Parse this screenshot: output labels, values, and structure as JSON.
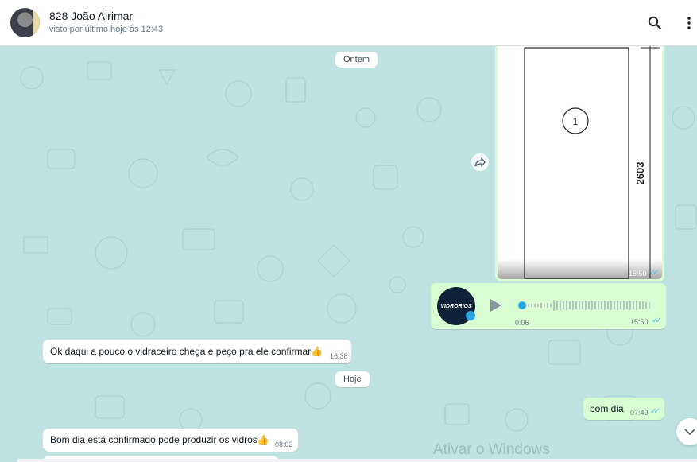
{
  "header": {
    "contact_name": "828 João Alrimar",
    "last_seen": "visto por último hoje às 12:43",
    "search_icon": "search-icon",
    "menu_icon": "more-vertical-icon"
  },
  "image_message": {
    "dimension_label": "2603",
    "circle_label": "1",
    "time": "15:50",
    "status": "read"
  },
  "date_separators": [
    "Ontem",
    "Hoje"
  ],
  "voice_message": {
    "logo_text": "VIDRORIOS",
    "duration": "0:06",
    "time": "15:50",
    "progress": 0
  },
  "messages": [
    {
      "direction": "in",
      "text": "Ok daqui a pouco o vidraceiro chega e peço pra ele confirmar👍",
      "time": "16:38"
    },
    {
      "direction": "out",
      "text": "bom dia",
      "time": "07:49"
    },
    {
      "direction": "in",
      "text": "Bom dia está confirmado pode produzir os vidros👍",
      "time": "08:02"
    }
  ],
  "watermark": "Ativar o Windows",
  "colors": {
    "outgoing": "#d9fdd3",
    "incoming": "#ffffff",
    "chat_bg": "#bfe3e0",
    "read_ticks": "#53bdeb"
  }
}
